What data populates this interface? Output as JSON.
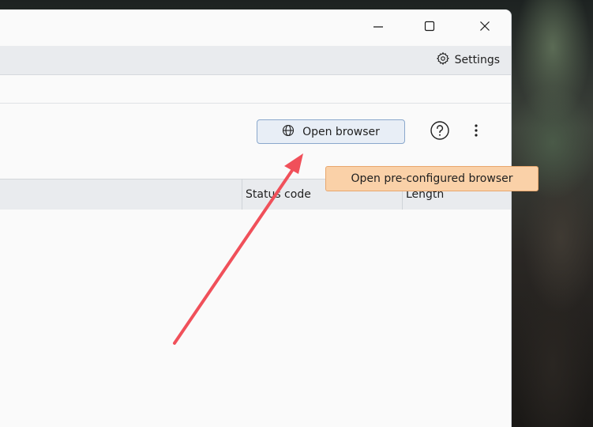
{
  "window": {
    "controls": {
      "minimize_icon": "minimize-icon",
      "maximize_icon": "maximize-icon",
      "close_icon": "close-icon"
    }
  },
  "settings_bar": {
    "settings_label": "Settings",
    "icon": "gear-icon"
  },
  "toolbar": {
    "open_browser_label": "Open browser",
    "open_browser_icon": "globe-icon",
    "help_icon": "help-icon",
    "more_icon": "more-vertical-icon"
  },
  "tooltip": {
    "text": "Open pre-configured browser"
  },
  "table": {
    "columns": [
      "Status code",
      "Length"
    ]
  },
  "colors": {
    "tooltip_bg": "#fad1a8",
    "tooltip_border": "#e8a76e",
    "button_bg": "#e8eef6",
    "button_border": "#8aa8cc",
    "annotation_arrow": "#f0505a"
  }
}
